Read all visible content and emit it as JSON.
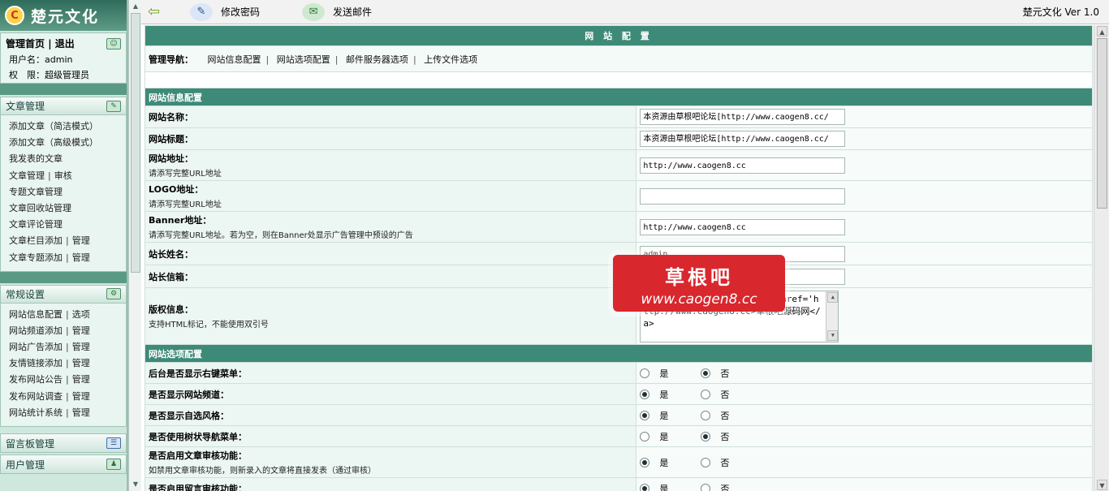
{
  "left": {
    "logo": "楚元文化",
    "user": {
      "home": "管理首页",
      "logout": "退出",
      "username_line": "用户名：admin",
      "role_line": "权　限：超级管理员"
    },
    "article": {
      "title": "文章管理",
      "items": [
        "添加文章（简洁模式）",
        "添加文章（高级模式）",
        "我发表的文章",
        [
          "文章管理",
          "审核"
        ],
        "专题文章管理",
        "文章回收站管理",
        "文章评论管理",
        [
          "文章栏目添加",
          "管理"
        ],
        [
          "文章专题添加",
          "管理"
        ]
      ]
    },
    "settings": {
      "title": "常规设置",
      "items": [
        [
          "网站信息配置",
          "选项"
        ],
        [
          "网站频道添加",
          "管理"
        ],
        [
          "网站广告添加",
          "管理"
        ],
        [
          "友情链接添加",
          "管理"
        ],
        [
          "发布网站公告",
          "管理"
        ],
        [
          "发布网站调查",
          "管理"
        ],
        [
          "网站统计系统",
          "管理"
        ]
      ]
    },
    "guestbook": "留言板管理",
    "users": "用户管理"
  },
  "topbar": {
    "change_password": "修改密码",
    "send_mail": "发送邮件",
    "version": "楚元文化 Ver 1.0"
  },
  "page": {
    "title": "网 站 配 置",
    "nav_label": "管理导航：",
    "nav_links": [
      "网站信息配置",
      "网站选项配置",
      "邮件服务器选项",
      "上传文件选项"
    ]
  },
  "section_info": {
    "title": "网站信息配置",
    "site_name": {
      "label": "网站名称：",
      "value": "本资源由草根吧论坛[http://www.caogen8.cc/"
    },
    "site_title": {
      "label": "网站标题：",
      "value": "本资源由草根吧论坛[http://www.caogen8.cc/"
    },
    "site_url": {
      "label": "网站地址：",
      "hint": "请添写完整URL地址",
      "value": "http://www.caogen8.cc"
    },
    "logo_url": {
      "label": "LOGO地址：",
      "hint": "请添写完整URL地址",
      "value": ""
    },
    "banner_url": {
      "label": "Banner地址：",
      "hint": "请添写完整URL地址。若为空，则在Banner处显示广告管理中预设的广告",
      "value": "http://www.caogen8.cc"
    },
    "webmaster_name": {
      "label": "站长姓名：",
      "value": "admin"
    },
    "webmaster_email": {
      "label": "站长信箱：",
      "value": "28612680163.com"
    },
    "copyright": {
      "label": "版权信息：",
      "hint": "支持HTML标记，不能使用双引号",
      "value": "版权所有 Copyright@2011 <a href='http://www.caogen8.cc>草根吧源码网</a>"
    }
  },
  "section_options": {
    "title": "网站选项配置",
    "yes": "是",
    "no": "否",
    "items": [
      {
        "label": "后台是否显示右键菜单：",
        "hint": "",
        "selected": "no"
      },
      {
        "label": "是否显示网站频道：",
        "hint": "",
        "selected": "yes"
      },
      {
        "label": "是否显示自选风格：",
        "hint": "",
        "selected": "yes"
      },
      {
        "label": "是否使用树状导航菜单：",
        "hint": "",
        "selected": "no"
      },
      {
        "label": "是否启用文章审核功能：",
        "hint": "如禁用文章审核功能，则新录入的文章将直接发表（通过审核）",
        "selected": "yes"
      },
      {
        "label": "是否启用留言审核功能：",
        "hint": "",
        "selected": "yes"
      }
    ]
  },
  "watermark": {
    "text": "草根吧",
    "url": "www.caogen8.cc"
  },
  "colors": {
    "header_green": "#3e8a78",
    "sidebar_bg": "#cfe8de"
  }
}
